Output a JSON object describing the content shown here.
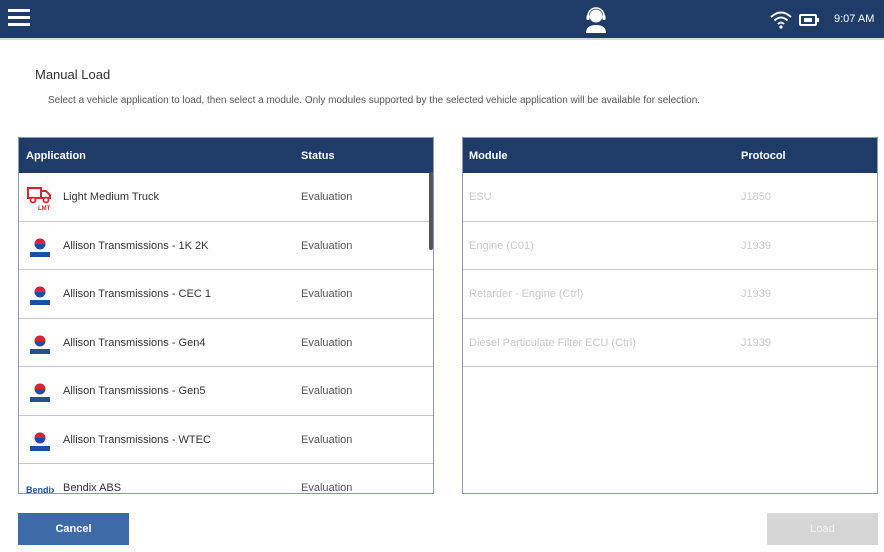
{
  "topbar": {
    "menu_icon": "hamburger-menu-icon",
    "center_icon": "support-agent-icon",
    "wifi_icon": "wifi-icon",
    "battery_icon": "battery-icon",
    "time": "9:07 AM"
  },
  "page": {
    "title": "Manual Load",
    "instructions": "Select a vehicle application to load, then select a module. Only modules supported by the selected vehicle application will be available for selection."
  },
  "applications": {
    "headers": {
      "application": "Application",
      "status": "Status"
    },
    "rows": [
      {
        "icon": "truck-lmt-icon",
        "name": "Light Medium Truck",
        "status": "Evaluation"
      },
      {
        "icon": "allison-logo-icon",
        "name": "Allison Transmissions - 1K 2K",
        "status": "Evaluation"
      },
      {
        "icon": "allison-logo-icon",
        "name": "Allison Transmissions - CEC 1",
        "status": "Evaluation"
      },
      {
        "icon": "allison-logo-icon",
        "name": "Allison Transmissions - Gen4",
        "status": "Evaluation"
      },
      {
        "icon": "allison-logo-icon",
        "name": "Allison Transmissions - Gen5",
        "status": "Evaluation"
      },
      {
        "icon": "allison-logo-icon",
        "name": "Allison Transmissions - WTEC",
        "status": "Evaluation"
      },
      {
        "icon": "bendix-logo-icon",
        "name": "Bendix ABS",
        "status": "Evaluation"
      }
    ]
  },
  "modules": {
    "headers": {
      "module": "Module",
      "protocol": "Protocol"
    },
    "rows": [
      {
        "name": "ESU",
        "protocol": "J1850"
      },
      {
        "name": "Engine (C01)",
        "protocol": "J1939"
      },
      {
        "name": "Retarder - Engine (Ctrl)",
        "protocol": "J1939"
      },
      {
        "name": "Diesel Particulate Filter ECU (Ctrl)",
        "protocol": "J1939"
      }
    ]
  },
  "buttons": {
    "cancel": "Cancel",
    "load": "Load"
  },
  "colors": {
    "header_navy": "#1f3b68",
    "cancel_blue": "#3f6aa8",
    "disabled_gray": "#d6d6d6",
    "truck_red": "#d9262c",
    "allison_red": "#d9262c",
    "allison_blue": "#1f4e9c"
  }
}
